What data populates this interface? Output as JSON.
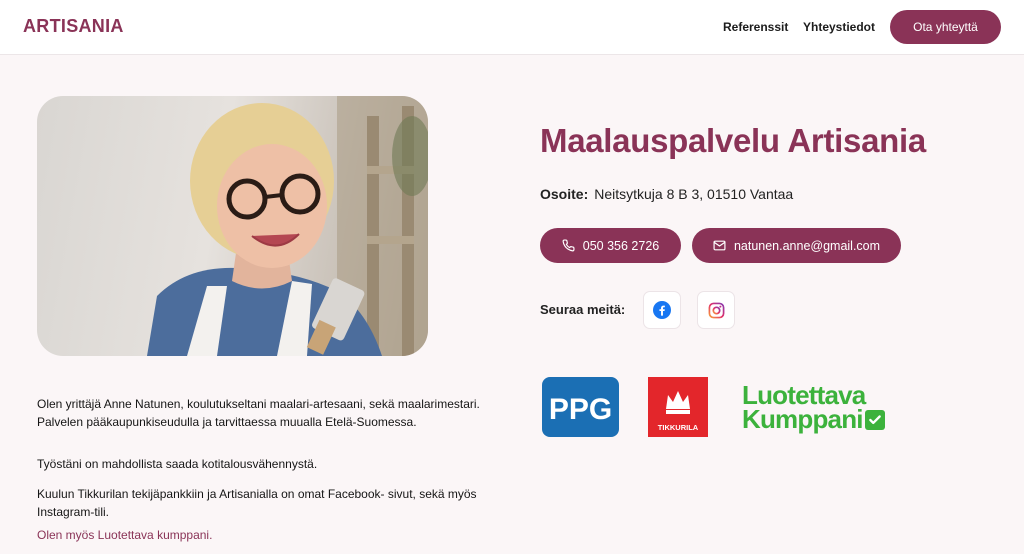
{
  "header": {
    "logo": "ARTISANIA",
    "nav": {
      "references": "Referenssit",
      "contacts": "Yhteystiedot"
    },
    "cta_label": "Ota yhteyttä"
  },
  "main": {
    "title": "Maalauspalvelu Artisania",
    "address": {
      "label": "Osoite:",
      "value": "Neitsytkuja 8 B 3, 01510 Vantaa"
    },
    "phone": "050 356 2726",
    "email": "natunen.anne@gmail.com",
    "follow_label": "Seuraa meitä:",
    "social": [
      "facebook-icon",
      "instagram-icon"
    ]
  },
  "intro": {
    "p1": "Olen yrittäjä Anne Natunen, koulutukseltani maalari-artesaani, sekä maalarimestari. Palvelen pääkaupunkiseudulla ja tarvittaessa muualla Etelä-Suomessa.",
    "p2": "Työstäni on mahdollista saada kotitalousvähennystä.",
    "p3": "Kuulun Tikkurilan tekijäpankkiin ja Artisanialla on omat Facebook- sivut, sekä myös Instagram-tili.",
    "p4": "Olen myös Luotettava kumppani."
  },
  "partner_logos": {
    "ppg": "PPG",
    "tikkurila": "TIKKURILA",
    "luotettava_line1": "Luotettava",
    "luotettava_line2": "Kumppani"
  },
  "colors": {
    "brand": "#8a3357",
    "background": "#fbf6f7",
    "ppg_blue": "#1b6fb4",
    "tikkurila_red": "#e3262b",
    "luotettava_green": "#3cb23c"
  }
}
